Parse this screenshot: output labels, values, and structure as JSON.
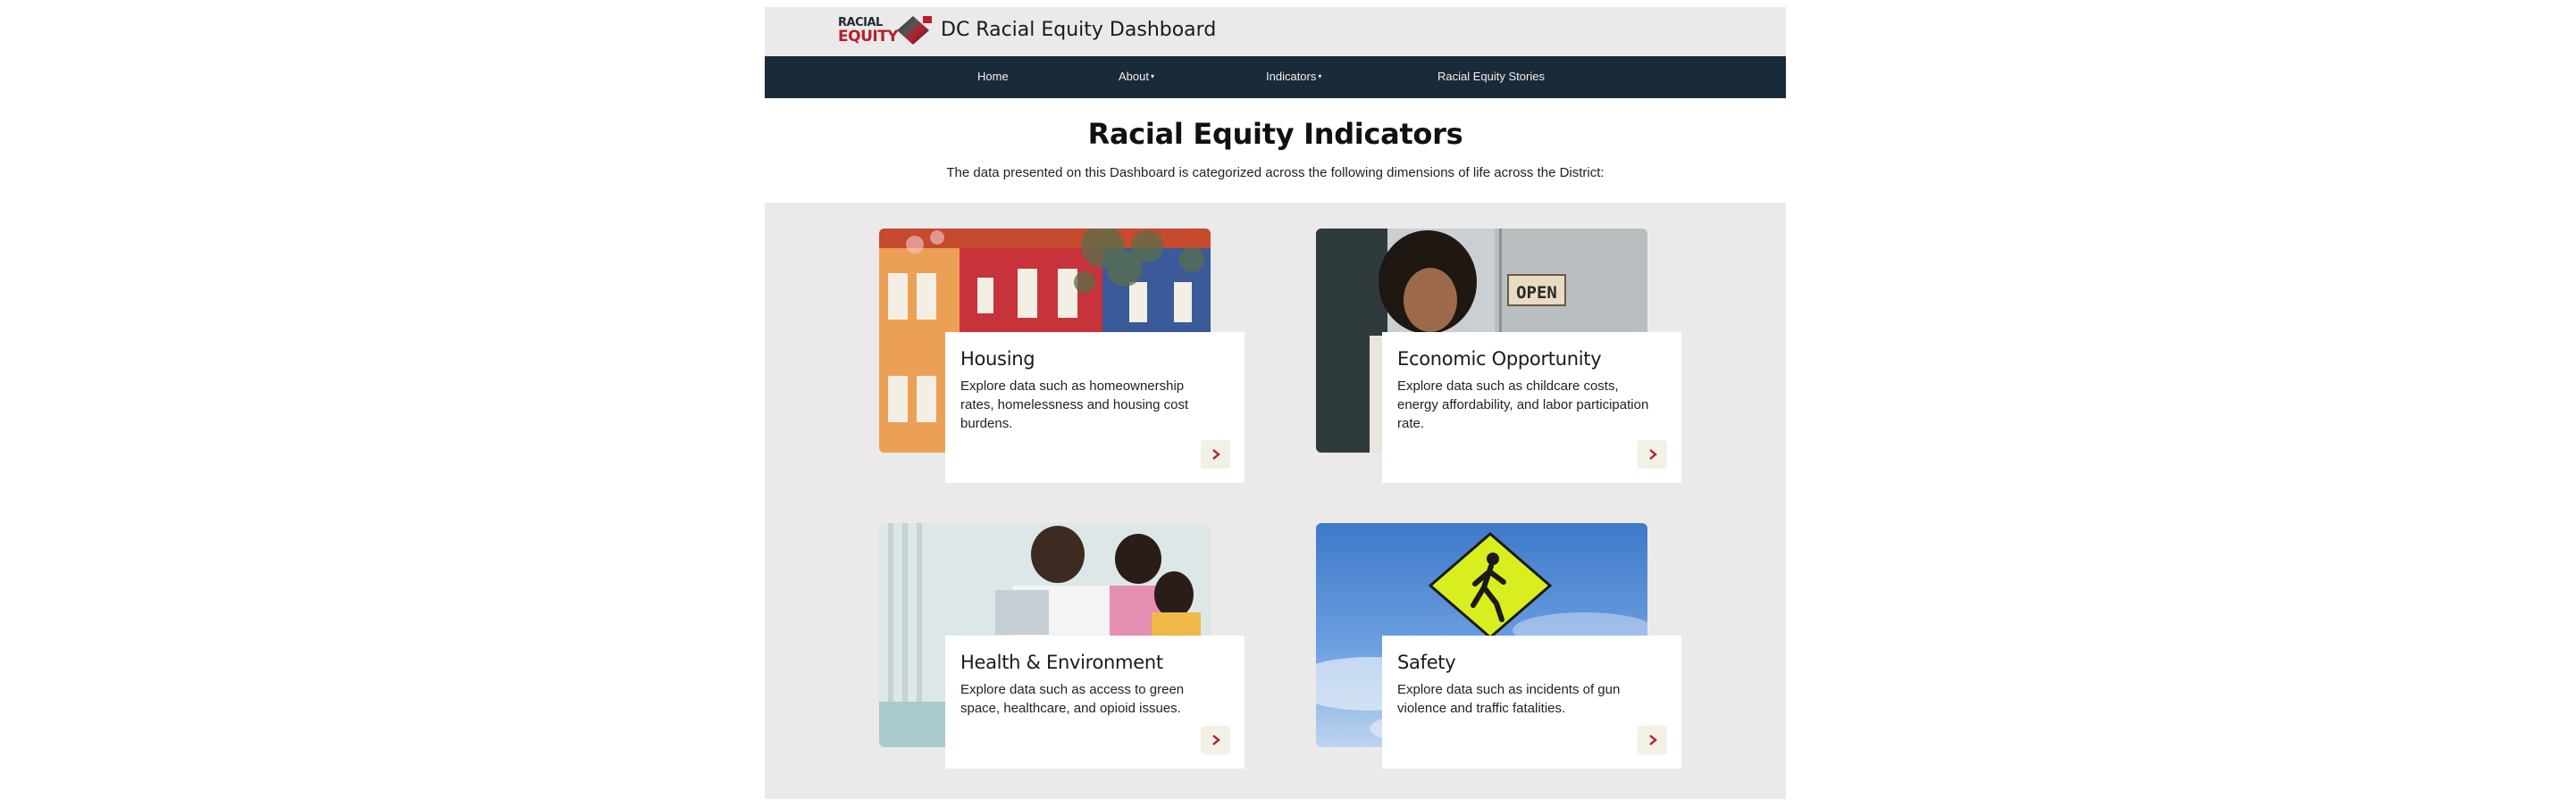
{
  "header": {
    "logo_line1": "RACIAL",
    "logo_line2": "EQUITY",
    "title": "DC Racial Equity Dashboard"
  },
  "nav": {
    "items": [
      {
        "label": "Home"
      },
      {
        "label": "About"
      },
      {
        "label": "Indicators"
      },
      {
        "label": "Racial Equity Stories"
      }
    ]
  },
  "main": {
    "title": "Racial Equity Indicators",
    "intro": "The data presented on this Dashboard is categorized across the following dimensions of life across the District:"
  },
  "cards": [
    {
      "title": "Housing",
      "description": "Explore data such as homeownership rates, homelessness and housing cost burdens."
    },
    {
      "title": "Economic Opportunity",
      "description": "Explore data such as childcare costs, energy affordability, and labor participation rate."
    },
    {
      "title": "Health & Environment",
      "description": "Explore data such as access to green space, healthcare, and opioid issues."
    },
    {
      "title": "Safety",
      "description": "Explore data such as incidents of gun violence and traffic fatalities."
    }
  ],
  "photo_text": {
    "open_sign": "OPEN"
  },
  "colors": {
    "nav_background": "#192a38",
    "header_background": "#ebe9e9",
    "arrow_color": "#b3202c",
    "arrow_background": "#f3f0e6"
  }
}
